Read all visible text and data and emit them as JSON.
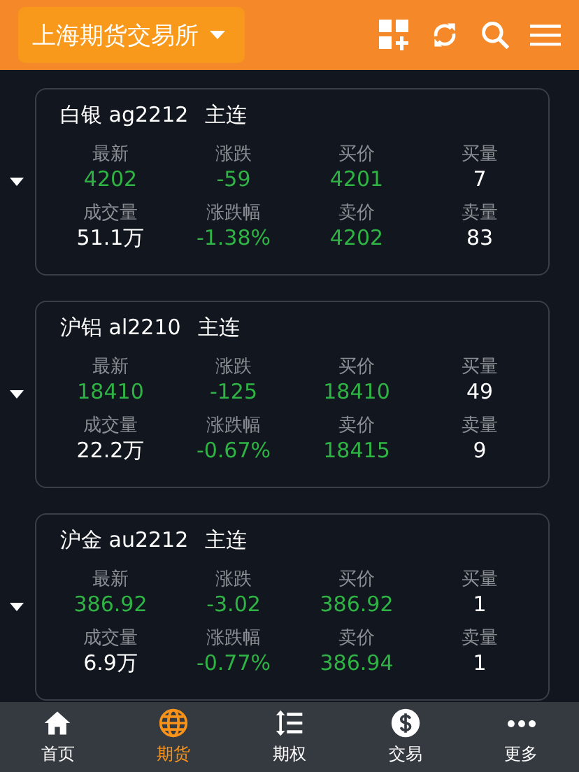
{
  "header": {
    "exchange": "上海期货交易所"
  },
  "quotes": [
    {
      "title": "白银 ag2212",
      "tag": "主连",
      "cells": [
        {
          "label": "最新",
          "value": "4202",
          "color": "#2fb344"
        },
        {
          "label": "涨跌",
          "value": "-59",
          "color": "#2fb344"
        },
        {
          "label": "买价",
          "value": "4201",
          "color": "#2fb344"
        },
        {
          "label": "买量",
          "value": "7",
          "color": "#ffffff"
        },
        {
          "label": "成交量",
          "value": "51.1万",
          "color": "#ffffff"
        },
        {
          "label": "涨跌幅",
          "value": "-1.38%",
          "color": "#2fb344"
        },
        {
          "label": "卖价",
          "value": "4202",
          "color": "#2fb344"
        },
        {
          "label": "卖量",
          "value": "83",
          "color": "#ffffff"
        }
      ]
    },
    {
      "title": "沪铝 al2210",
      "tag": "主连",
      "cells": [
        {
          "label": "最新",
          "value": "18410",
          "color": "#2fb344"
        },
        {
          "label": "涨跌",
          "value": "-125",
          "color": "#2fb344"
        },
        {
          "label": "买价",
          "value": "18410",
          "color": "#2fb344"
        },
        {
          "label": "买量",
          "value": "49",
          "color": "#ffffff"
        },
        {
          "label": "成交量",
          "value": "22.2万",
          "color": "#ffffff"
        },
        {
          "label": "涨跌幅",
          "value": "-0.67%",
          "color": "#2fb344"
        },
        {
          "label": "卖价",
          "value": "18415",
          "color": "#2fb344"
        },
        {
          "label": "卖量",
          "value": "9",
          "color": "#ffffff"
        }
      ]
    },
    {
      "title": "沪金 au2212",
      "tag": "主连",
      "cells": [
        {
          "label": "最新",
          "value": "386.92",
          "color": "#2fb344"
        },
        {
          "label": "涨跌",
          "value": "-3.02",
          "color": "#2fb344"
        },
        {
          "label": "买价",
          "value": "386.92",
          "color": "#2fb344"
        },
        {
          "label": "买量",
          "value": "1",
          "color": "#ffffff"
        },
        {
          "label": "成交量",
          "value": "6.9万",
          "color": "#ffffff"
        },
        {
          "label": "涨跌幅",
          "value": "-0.77%",
          "color": "#2fb344"
        },
        {
          "label": "卖价",
          "value": "386.94",
          "color": "#2fb344"
        },
        {
          "label": "卖量",
          "value": "1",
          "color": "#ffffff"
        }
      ]
    }
  ],
  "nav": [
    {
      "kind": "home",
      "label": "首页",
      "selected": false
    },
    {
      "kind": "globe",
      "label": "期货",
      "selected": true
    },
    {
      "kind": "sort",
      "label": "期权",
      "selected": false
    },
    {
      "kind": "dollar",
      "label": "交易",
      "selected": false
    },
    {
      "kind": "more",
      "label": "更多",
      "selected": false
    }
  ]
}
